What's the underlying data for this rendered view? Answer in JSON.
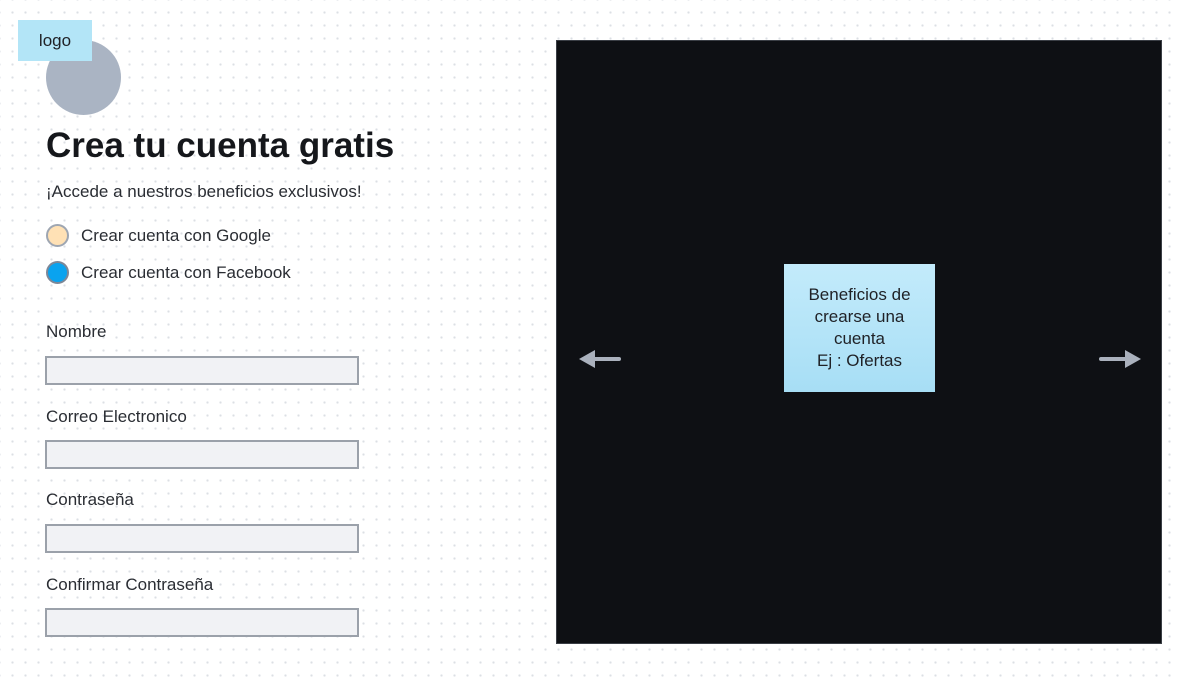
{
  "logo": {
    "label": "logo"
  },
  "header": {
    "title": "Crea tu cuenta gratis",
    "subtitle": "¡Accede a nuestros beneficios exclusivos!"
  },
  "social": {
    "google_label": "Crear cuenta con Google",
    "facebook_label": "Crear cuenta con Facebook"
  },
  "form": {
    "fields": [
      {
        "label": "Nombre",
        "value": ""
      },
      {
        "label": "Correo Electronico",
        "value": ""
      },
      {
        "label": "Contraseña",
        "value": ""
      },
      {
        "label": "Confirmar Contraseña",
        "value": ""
      }
    ]
  },
  "carousel": {
    "card_lines": [
      "Beneficios de",
      "crearse una",
      "cuenta",
      "Ej : Ofertas"
    ],
    "prev_icon": "arrow-left-icon",
    "next_icon": "arrow-right-icon"
  },
  "colors": {
    "note_blue": "#b3e5f7",
    "logo_gray": "#aab4c3",
    "carousel_bg": "#0e1014",
    "google_radio": "#ffe1b5",
    "facebook_radio": "#0aa3ef",
    "arrow_gray": "#aab1bd"
  }
}
